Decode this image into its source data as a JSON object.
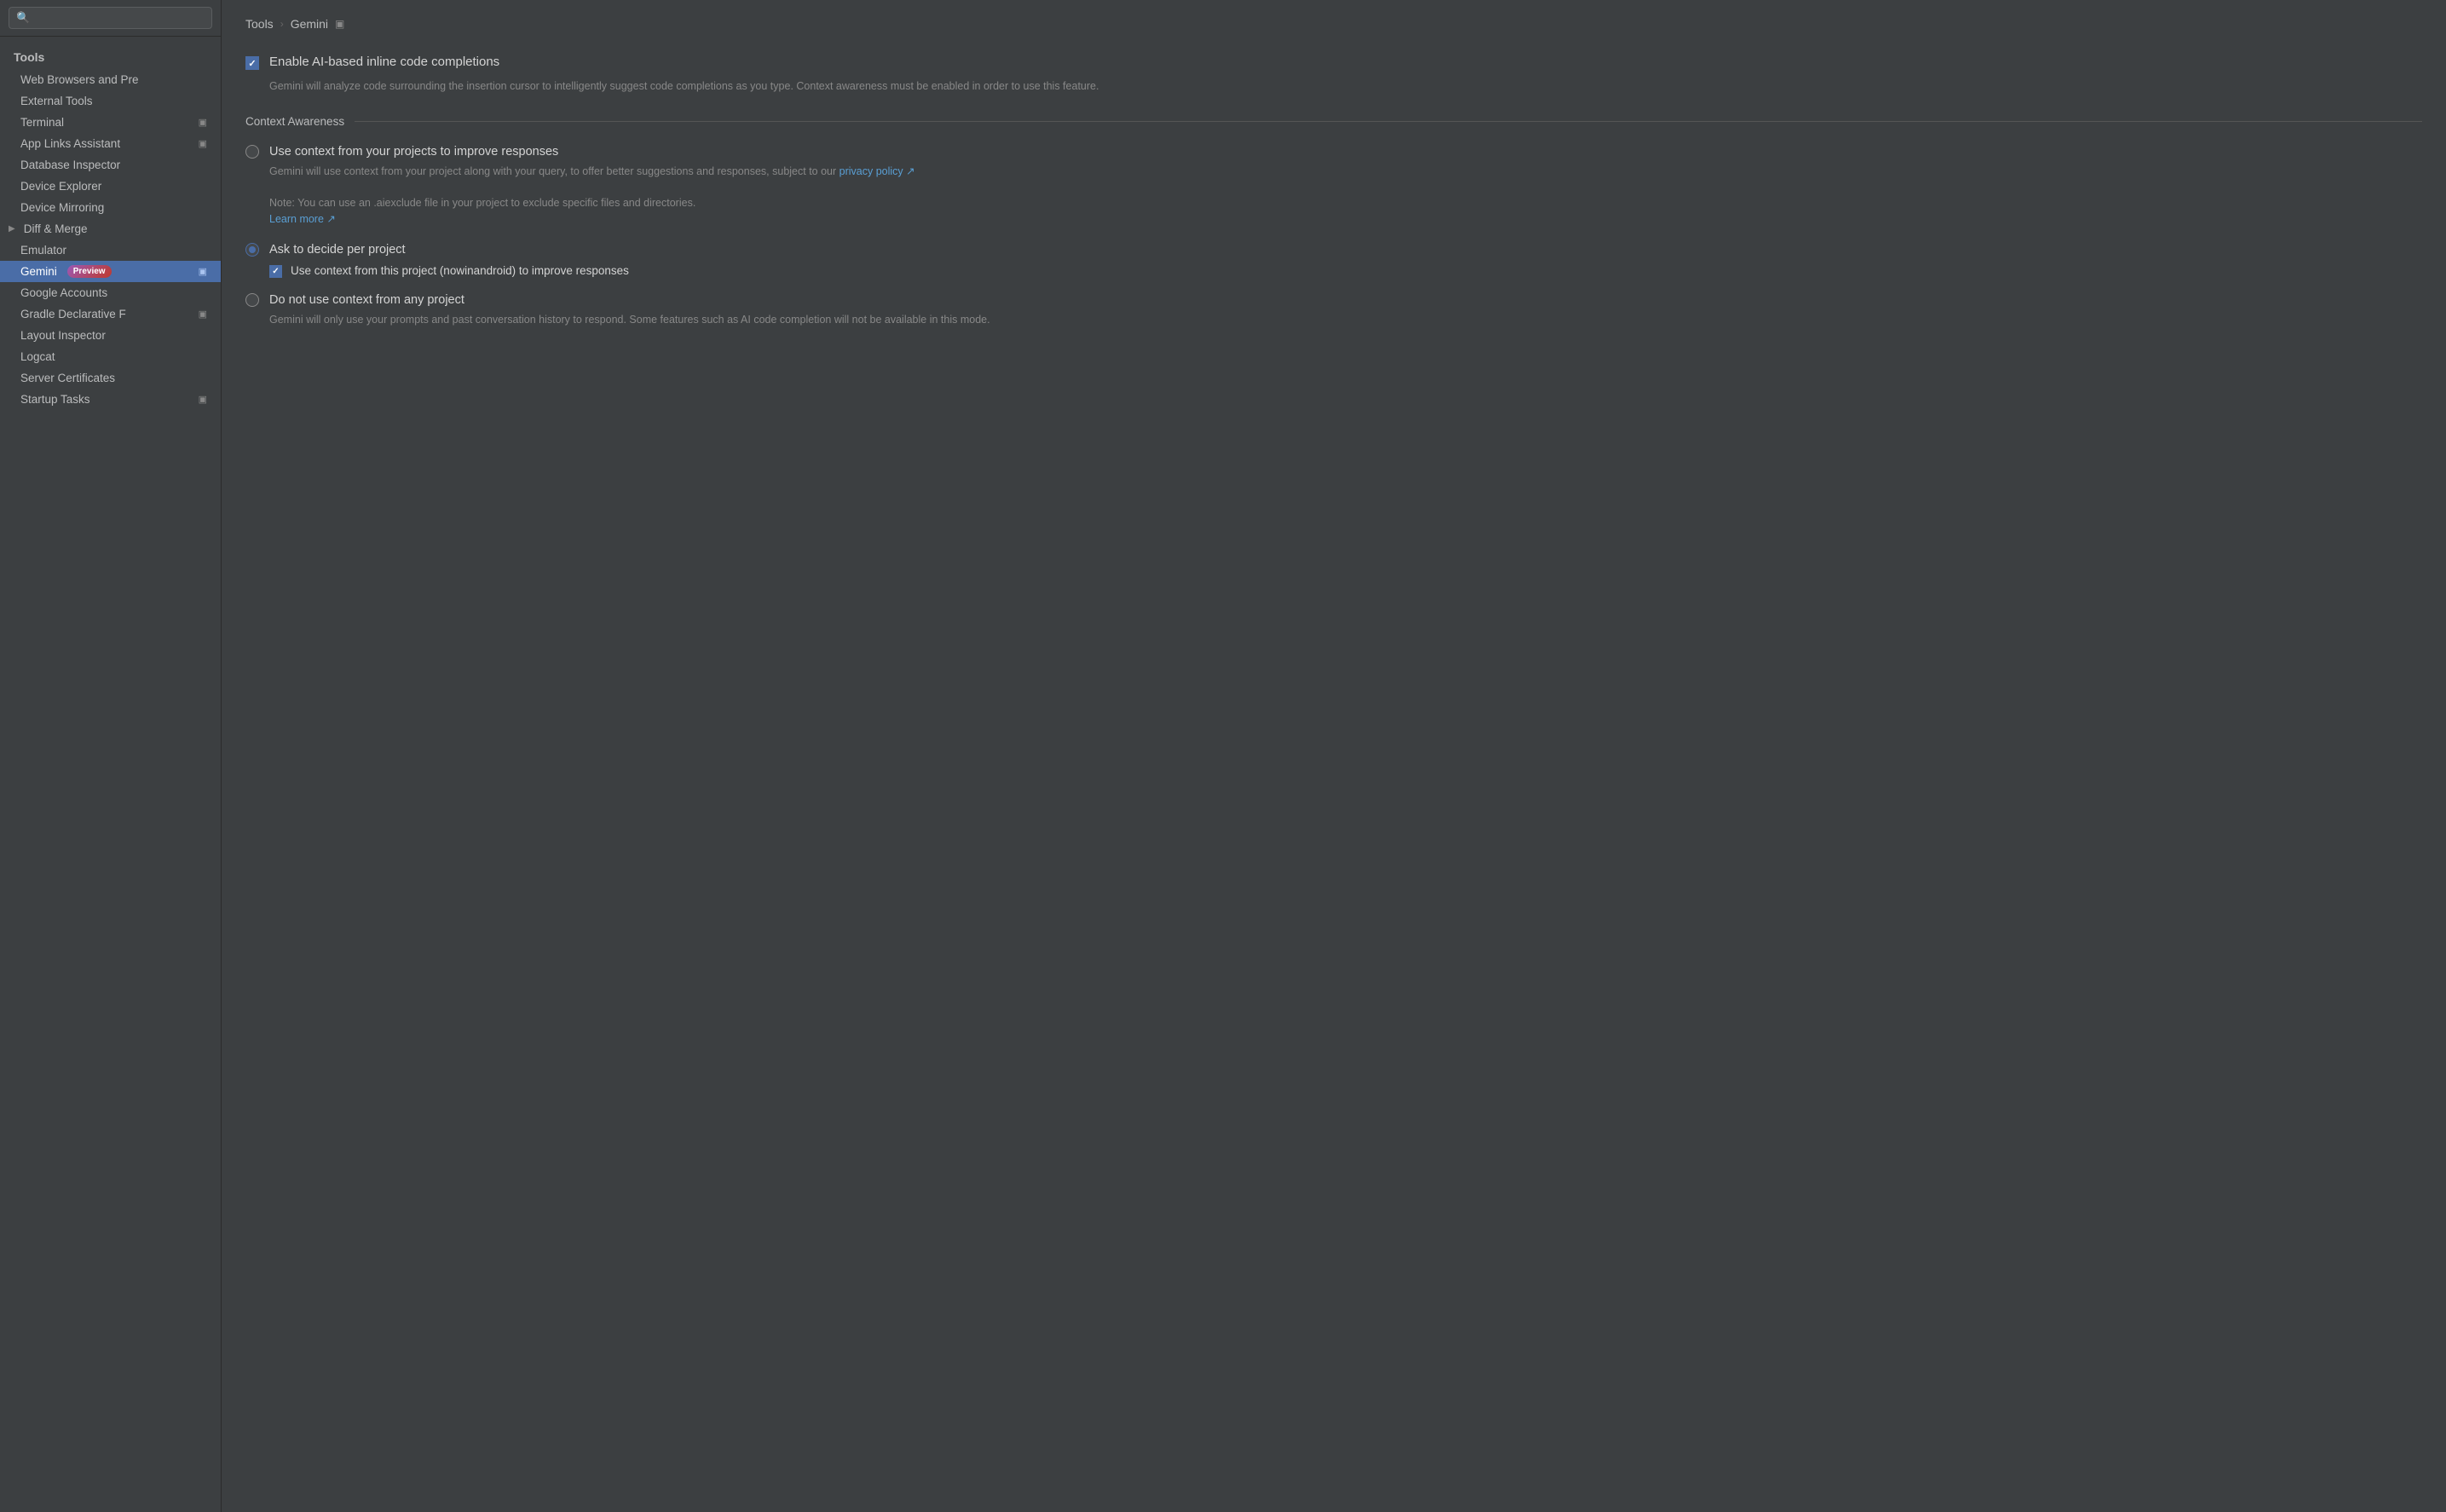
{
  "search": {
    "placeholder": ""
  },
  "sidebar": {
    "group_title": "Tools",
    "items": [
      {
        "label": "Web Browsers and Pre",
        "icon": null,
        "active": false,
        "indent": "normal",
        "chevron": false
      },
      {
        "label": "External Tools",
        "icon": null,
        "active": false,
        "indent": "normal",
        "chevron": false
      },
      {
        "label": "Terminal",
        "icon": "▣",
        "active": false,
        "indent": "normal",
        "chevron": false
      },
      {
        "label": "App Links Assistant",
        "icon": "▣",
        "active": false,
        "indent": "normal",
        "chevron": false
      },
      {
        "label": "Database Inspector",
        "icon": null,
        "active": false,
        "indent": "normal",
        "chevron": false
      },
      {
        "label": "Device Explorer",
        "icon": null,
        "active": false,
        "indent": "normal",
        "chevron": false
      },
      {
        "label": "Device Mirroring",
        "icon": null,
        "active": false,
        "indent": "normal",
        "chevron": false
      },
      {
        "label": "Diff & Merge",
        "icon": null,
        "active": false,
        "indent": "chevron",
        "chevron": true
      },
      {
        "label": "Emulator",
        "icon": null,
        "active": false,
        "indent": "normal",
        "chevron": false
      },
      {
        "label": "Gemini",
        "icon": "▣",
        "active": true,
        "indent": "normal",
        "chevron": false,
        "badge": "Preview"
      },
      {
        "label": "Google Accounts",
        "icon": null,
        "active": false,
        "indent": "normal",
        "chevron": false
      },
      {
        "label": "Gradle Declarative F",
        "icon": "▣",
        "active": false,
        "indent": "normal",
        "chevron": false
      },
      {
        "label": "Layout Inspector",
        "icon": null,
        "active": false,
        "indent": "normal",
        "chevron": false
      },
      {
        "label": "Logcat",
        "icon": null,
        "active": false,
        "indent": "normal",
        "chevron": false
      },
      {
        "label": "Server Certificates",
        "icon": null,
        "active": false,
        "indent": "normal",
        "chevron": false
      },
      {
        "label": "Startup Tasks",
        "icon": "▣",
        "active": false,
        "indent": "normal",
        "chevron": false
      }
    ]
  },
  "breadcrumb": {
    "root": "Tools",
    "separator": "›",
    "current": "Gemini",
    "icon": "▣"
  },
  "main": {
    "inline_completions": {
      "label": "Enable AI-based inline code completions",
      "description": "Gemini will analyze code surrounding the insertion cursor to intelligently suggest code completions as you type. Context awareness must be enabled in order to use this feature.",
      "checked": true
    },
    "context_awareness": {
      "section_label": "Context Awareness",
      "option_project": {
        "label": "Use context from your projects to improve responses",
        "description_before": "Gemini will use context from your project along with your query, to offer better suggestions and responses, subject to our",
        "link_label": "privacy policy ↗",
        "description_after": "Note: You can use an .aiexclude file in your project to exclude specific files and directories.",
        "learn_more_label": "Learn more ↗",
        "selected": false
      },
      "option_ask": {
        "label": "Ask to decide per project",
        "selected": true,
        "sub_checkbox": {
          "label": "Use context from this project (nowinandroid) to improve responses",
          "checked": true
        }
      },
      "option_none": {
        "label": "Do not use context from any project",
        "description": "Gemini will only use your prompts and past conversation history to respond. Some features such as AI code completion will not be available in this mode.",
        "selected": false
      }
    }
  }
}
